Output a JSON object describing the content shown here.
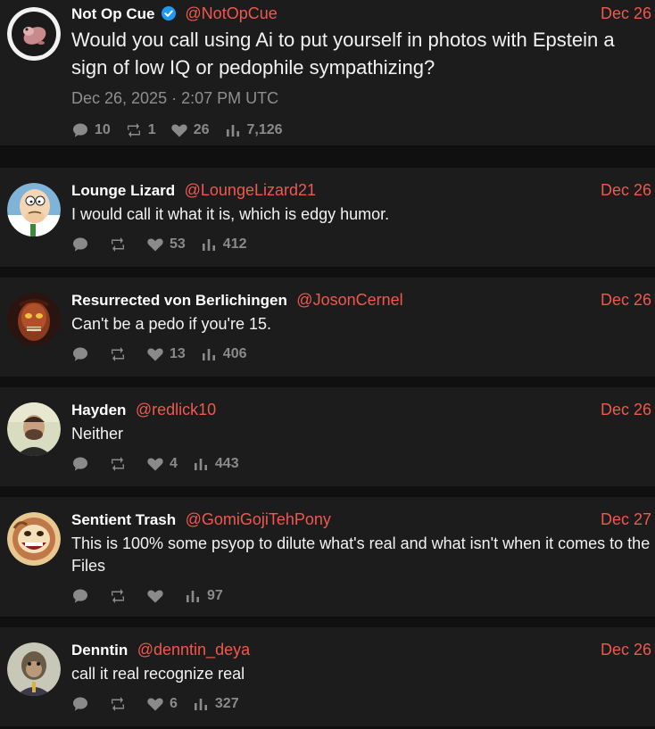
{
  "main": {
    "name": "Not Op Cue",
    "handle": "@NotOpCue",
    "date": "Dec 26",
    "text": "Would you call using Ai to put yourself in photos with Epstein a sign of low IQ or pedophile sympathizing?",
    "timestamp": "Dec 26, 2025 · 2:07 PM UTC",
    "replies": "10",
    "retweets": "1",
    "likes": "26",
    "views": "7,126"
  },
  "replies": [
    {
      "name": "Lounge Lizard",
      "handle": "@LoungeLizard21",
      "date": "Dec 26",
      "text": "I would call it what it is, which is edgy humor.",
      "likes": "53",
      "views": "412"
    },
    {
      "name": "Resurrected von Berlichingen",
      "handle": "@JosonCernel",
      "date": "Dec 26",
      "text": "Can't be a pedo if you're 15.",
      "likes": "13",
      "views": "406"
    },
    {
      "name": "Hayden",
      "handle": "@redlick10",
      "date": "Dec 26",
      "text": "Neither",
      "likes": "4",
      "views": "443"
    },
    {
      "name": "Sentient Trash",
      "handle": "@GomiGojiTehPony",
      "date": "Dec 27",
      "text": "This is 100% some psyop to dilute what's real and what isn't when it comes to the Files",
      "likes": "",
      "views": "97"
    },
    {
      "name": "Denntin",
      "handle": "@denntin_deya",
      "date": "Dec 26",
      "text": "call it real recognize real",
      "likes": "6",
      "views": "327"
    }
  ],
  "icons": {
    "reply": "comment-bubble-icon",
    "retweet": "retweet-icon",
    "like": "heart-icon",
    "views": "bar-chart-icon",
    "verified": "verified-badge-icon"
  },
  "colors": {
    "accent": "#f0584f",
    "background": "#101010",
    "card": "#1c1c1c",
    "muted": "#8a8a8a"
  }
}
